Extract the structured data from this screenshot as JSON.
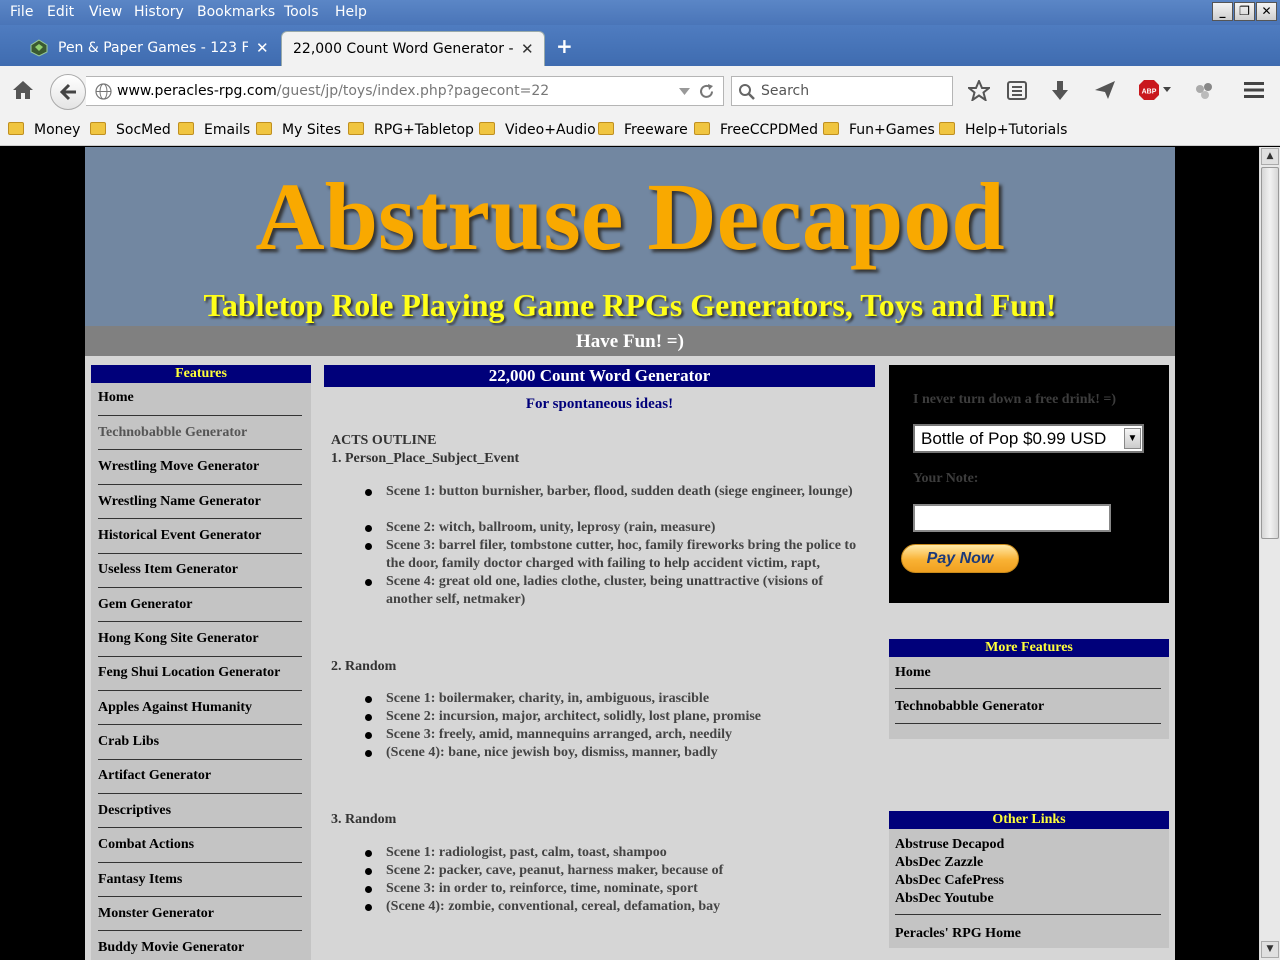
{
  "menu": [
    "File",
    "Edit",
    "View",
    "History",
    "Bookmarks",
    "Tools",
    "Help"
  ],
  "window_controls": {
    "minimize": "_",
    "maximize": "❐",
    "close": "✕"
  },
  "tabs": [
    {
      "title": "Pen & Paper Games - 123 Fla...",
      "close": "✕"
    },
    {
      "title": "22,000 Count Word Generator - ...",
      "close": "✕"
    }
  ],
  "new_tab": "+",
  "nav": {
    "url_domain": "www.peracles-rpg.com",
    "url_path": "/guest/jp/toys/index.php?pagecont=22",
    "search_placeholder": "Search"
  },
  "bookmarks": [
    "Money",
    "SocMed",
    "Emails",
    "My Sites",
    "RPG+Tabletop",
    "Video+Audio",
    "Freeware",
    "FreeCCPDMed",
    "Fun+Games",
    "Help+Tutorials"
  ],
  "site": {
    "title": "Abstruse Decapod",
    "subtitle": "Tabletop Role Playing Game RPGs Generators, Toys and Fun!",
    "tagline": "Have Fun! =)"
  },
  "features": {
    "header": "Features",
    "items": [
      "Home",
      "Technobabble Generator",
      "Wrestling Move Generator",
      "Wrestling Name Generator",
      "Historical Event Generator",
      "Useless Item Generator",
      "Gem Generator",
      "Hong Kong Site Generator",
      "Feng Shui Location Generator",
      "Apples Against Humanity",
      "Crab Libs",
      "Artifact Generator",
      "Descriptives",
      "Combat Actions",
      "Fantasy Items",
      "Monster Generator",
      "Buddy Movie Generator"
    ]
  },
  "generator": {
    "title": "22,000 Count Word Generator",
    "subtitle": "For spontaneous ideas!",
    "outline_heading": "ACTS OUTLINE",
    "acts": [
      {
        "heading": "1. Person_Place_Subject_Event",
        "scenes": [
          "Scene 1: button burnisher, barber, flood, sudden death (siege engineer, lounge)",
          "Scene 2: witch, ballroom, unity, leprosy (rain, measure)",
          "Scene 3: barrel filer, tombstone cutter, hoc, family fireworks bring the police to the door, family doctor charged with failing to help accident victim, rapt,",
          "Scene 4: great old one, ladies clothe, cluster, being unattractive (visions of another self, netmaker)"
        ]
      },
      {
        "heading": "2. Random",
        "scenes": [
          "Scene 1: boilermaker, charity, in, ambiguous, irascible",
          "Scene 2: incursion, major, architect, solidly, lost plane, promise",
          "Scene 3: freely, amid, mannequins arranged, arch, needily",
          "(Scene 4): bane, nice jewish boy, dismiss, manner, badly"
        ]
      },
      {
        "heading": "3. Random",
        "scenes": [
          "Scene 1: radiologist, past, calm, toast, shampoo",
          "Scene 2: packer, cave, peanut, harness maker, because of",
          "Scene 3: in order to, reinforce, time, nominate, sport",
          "(Scene 4): zombie, conventional, cereal, defamation, bay"
        ]
      }
    ]
  },
  "donate": {
    "note": "I never turn down a free drink! =)",
    "selected_option": "Bottle of Pop $0.99 USD",
    "your_note_label": "Your Note:",
    "your_note_value": "",
    "pay_button": "Pay Now"
  },
  "more_features": {
    "header": "More Features",
    "items": [
      "Home",
      "Technobabble Generator"
    ]
  },
  "other_links": {
    "header": "Other Links",
    "items": [
      "Abstruse Decapod",
      "AbsDec Zazzle",
      "AbsDec CafePress",
      "AbsDec Youtube"
    ],
    "home": "Peracles' RPG Home"
  },
  "scrollbar": {
    "up": "▲",
    "down": "▼"
  }
}
